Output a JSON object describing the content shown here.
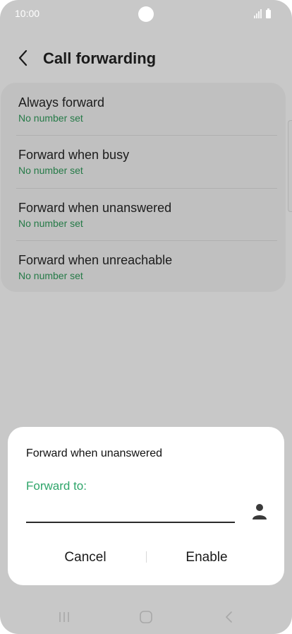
{
  "status_bar": {
    "time": "10:00"
  },
  "header": {
    "title": "Call forwarding"
  },
  "list": {
    "items": [
      {
        "title": "Always forward",
        "subtitle": "No number set"
      },
      {
        "title": "Forward when busy",
        "subtitle": "No number set"
      },
      {
        "title": "Forward when unanswered",
        "subtitle": "No number set"
      },
      {
        "title": "Forward when unreachable",
        "subtitle": "No number set"
      }
    ]
  },
  "dialog": {
    "title": "Forward when unanswered",
    "field_label": "Forward to:",
    "field_value": "",
    "cancel_label": "Cancel",
    "enable_label": "Enable"
  },
  "icons": {
    "back": "chevron-left-icon",
    "contact": "person-icon",
    "nav_recent": "recent-apps-icon",
    "nav_home": "home-icon",
    "nav_back": "nav-back-icon"
  },
  "colors": {
    "accent": "#2ea56a",
    "subtitle": "#257a47",
    "background": "#c8c8c8",
    "card": "#c0c0c0",
    "dialog": "#ffffff"
  }
}
